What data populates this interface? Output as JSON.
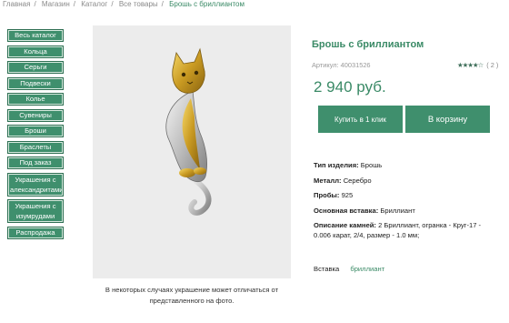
{
  "breadcrumb": [
    "Главная",
    "Магазин",
    "Каталог",
    "Все товары",
    "Брошь с бриллиантом"
  ],
  "sidebar": {
    "items": [
      {
        "label": "Весь каталог"
      },
      {
        "label": "Кольца"
      },
      {
        "label": "Серьги"
      },
      {
        "label": "Подвески"
      },
      {
        "label": "Колье"
      },
      {
        "label": "Сувениры"
      },
      {
        "label": "Броши"
      },
      {
        "label": "Браслеты"
      },
      {
        "label": "Под заказ"
      },
      {
        "label": "Украшения с александритами"
      },
      {
        "label": "Украшения с изумрудами"
      },
      {
        "label": "Распродажа"
      }
    ]
  },
  "product": {
    "title": "Брошь с бриллиантом",
    "article": "Артикул: 40031526",
    "rating_count": "( 2 )",
    "rating_value": 3.5,
    "rating_max": 5,
    "price": "2 940 руб.",
    "image_caption": "В некоторых случаях украшение может отличаться от представленного на фото.",
    "buttons": {
      "one_click": "Купить в 1 клик",
      "cart": "В корзину"
    },
    "properties": [
      {
        "key": "Тип изделия:",
        "value": "Брошь"
      },
      {
        "key": "Металл:",
        "value": "Серебро"
      },
      {
        "key": "Пробы:",
        "value": "925"
      },
      {
        "key": "Основная вставка:",
        "value": "Бриллиант"
      },
      {
        "key": "Описание камней:",
        "value": "2 Бриллиант, огранка - Круг-17 - 0.006 карат, 2/4, размер - 1.0 мм;"
      }
    ],
    "insert": {
      "label": "Вставка",
      "value": "бриллиант"
    }
  },
  "colors": {
    "accent": "#3f8f6d",
    "accent_text": "#3a8a66",
    "photo_bg": "#ececec"
  },
  "icons": {
    "rating": "star-icon"
  }
}
